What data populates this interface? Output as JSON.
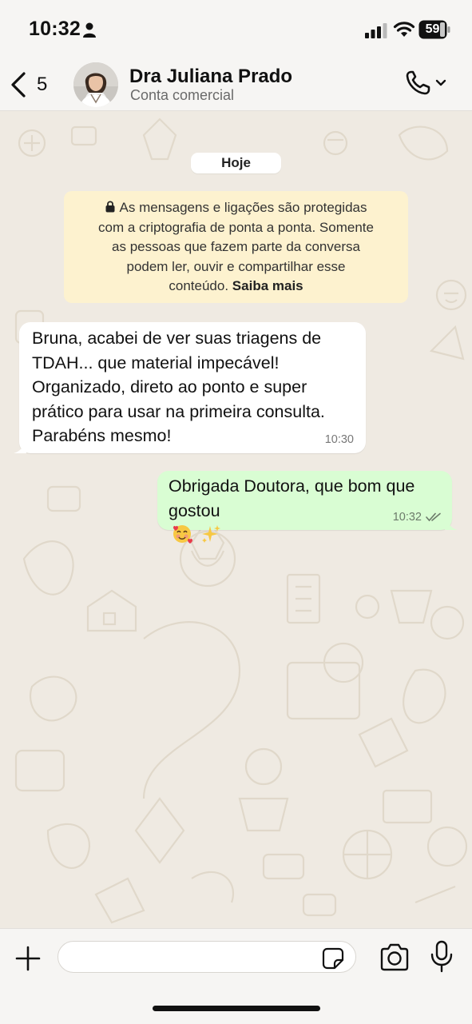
{
  "status_bar": {
    "time": "10:32",
    "battery": "59"
  },
  "header": {
    "back_count": "5",
    "contact_name": "Dra Juliana Prado",
    "contact_subtitle": "Conta comercial"
  },
  "chat": {
    "date_chip": "Hoje",
    "encryption_notice": {
      "line1": "As mensagens e ligações são protegidas",
      "line2": "com a criptografia de ponta a ponta. Somente",
      "line3": "as pessoas que fazem parte da conversa",
      "line4": "podem ler, ouvir e compartilhar esse",
      "line5": "conteúdo.",
      "link": "Saiba mais"
    },
    "messages": [
      {
        "direction": "incoming",
        "lines": [
          "Bruna, acabei de ver suas triagens de",
          "TDAH... que material impecável!",
          "Organizado, direto ao ponto e super",
          "prático para usar na primeira consulta.",
          "Parabéns mesmo!"
        ],
        "time": "10:30"
      },
      {
        "direction": "outgoing",
        "lines": [
          "Obrigada Doutora, que bom que",
          "gostou"
        ],
        "emojis": [
          "smiling-face-with-hearts",
          "sparkles"
        ],
        "time": "10:32",
        "status": "read"
      }
    ]
  },
  "composer": {
    "placeholder": ""
  },
  "colors": {
    "chat_background": "#efeae2",
    "incoming_bubble": "#ffffff",
    "outgoing_bubble": "#d9fdd3",
    "notice_background": "#fdf2cf",
    "bar_background": "#f6f5f3"
  }
}
